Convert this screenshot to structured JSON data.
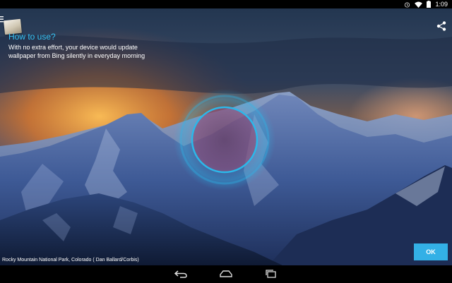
{
  "status_bar": {
    "time": "1:09",
    "icons": [
      "alarm-icon",
      "wifi-icon",
      "battery-icon"
    ]
  },
  "header": {
    "icons": [
      "menu-icon",
      "app-thumbnail",
      "share-icon"
    ]
  },
  "hint": {
    "title": "How to use?",
    "body": "With no extra effort, your device would update\nwallpaper from Bing silently in everyday morning"
  },
  "wallpaper": {
    "caption": "Rocky Mountain National Park, Colorado ( Dan Ballard/Corbis)"
  },
  "actions": {
    "ok_label": "OK"
  },
  "nav_bar": {
    "icons": [
      "back-icon",
      "home-icon",
      "recents-icon"
    ]
  },
  "colors": {
    "accent": "#33b0e6",
    "hint_title": "#36c2f2",
    "ring": "#2bb8ea"
  }
}
